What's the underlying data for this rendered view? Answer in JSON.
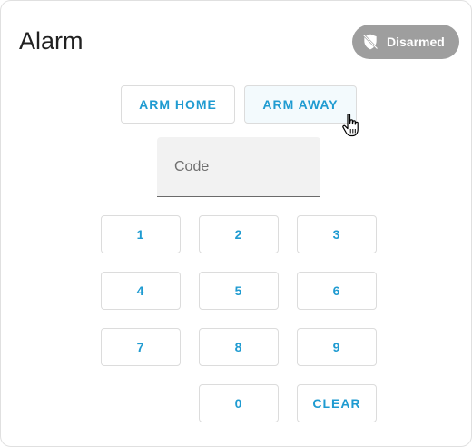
{
  "card": {
    "title": "Alarm",
    "state_badge": {
      "label": "Disarmed",
      "icon": "shield-off-icon",
      "color": "#9e9e9e"
    }
  },
  "actions": {
    "arm_home": "ARM HOME",
    "arm_away": "ARM AWAY"
  },
  "code_field": {
    "placeholder": "Code",
    "value": ""
  },
  "keypad": {
    "k1": "1",
    "k2": "2",
    "k3": "3",
    "k4": "4",
    "k5": "5",
    "k6": "6",
    "k7": "7",
    "k8": "8",
    "k9": "9",
    "k0": "0",
    "clear": "CLEAR"
  },
  "colors": {
    "accent": "#1f9bd1",
    "badge": "#9e9e9e",
    "text": "#212121"
  }
}
